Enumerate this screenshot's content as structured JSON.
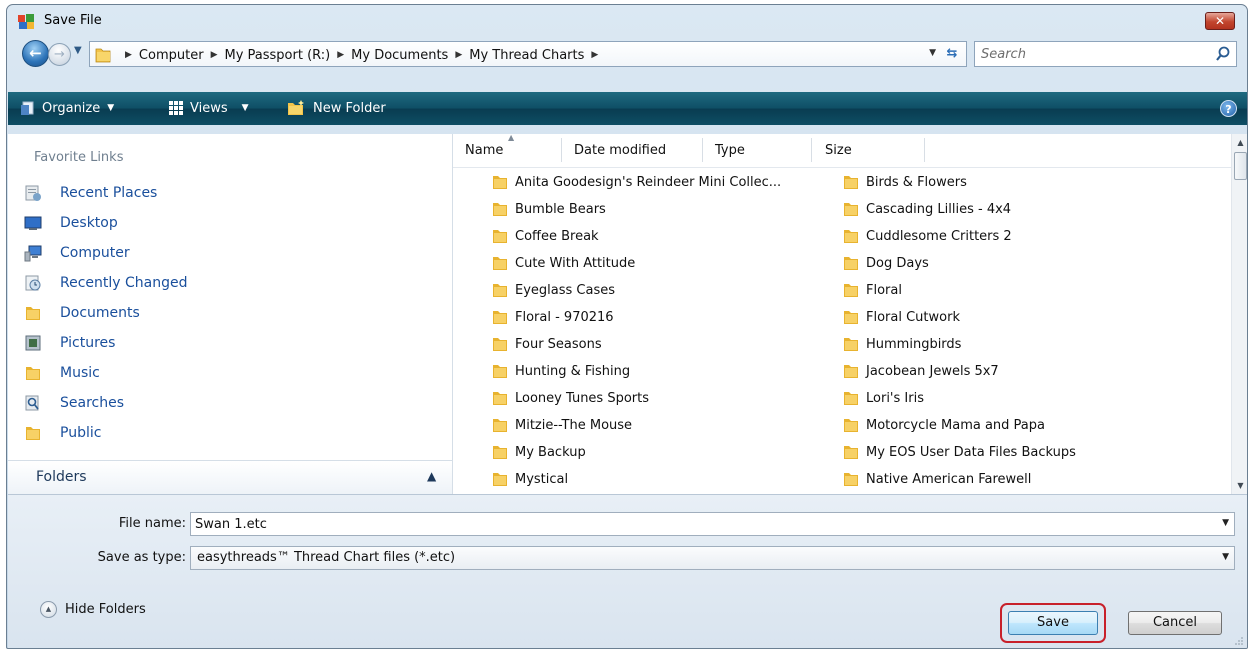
{
  "window": {
    "title": "Save File",
    "close_label": "✕"
  },
  "nav": {
    "breadcrumbs": [
      "Computer",
      "My Passport (R:)",
      "My Documents",
      "My Thread Charts"
    ],
    "search_placeholder": "Search"
  },
  "toolbar": {
    "organize": "Organize",
    "views": "Views",
    "new_folder": "New Folder",
    "help": "?"
  },
  "favorites": {
    "header": "Favorite Links",
    "items": [
      {
        "label": "Recent Places",
        "icon": "recent-places-icon"
      },
      {
        "label": "Desktop",
        "icon": "desktop-icon"
      },
      {
        "label": "Computer",
        "icon": "computer-icon"
      },
      {
        "label": "Recently Changed",
        "icon": "recently-changed-icon"
      },
      {
        "label": "Documents",
        "icon": "documents-folder-icon"
      },
      {
        "label": "Pictures",
        "icon": "pictures-icon"
      },
      {
        "label": "Music",
        "icon": "music-folder-icon"
      },
      {
        "label": "Searches",
        "icon": "searches-icon"
      },
      {
        "label": "Public",
        "icon": "public-folder-icon"
      }
    ],
    "folders_label": "Folders"
  },
  "columns": [
    "Name",
    "Date modified",
    "Type",
    "Size"
  ],
  "files": {
    "col1": [
      "Anita Goodesign's Reindeer Mini Collec...",
      "Bumble Bears",
      "Coffee Break",
      "Cute With Attitude",
      "Eyeglass Cases",
      "Floral - 970216",
      "Four Seasons",
      "Hunting & Fishing",
      "Looney Tunes Sports",
      "Mitzie--The Mouse",
      "My Backup",
      "Mystical"
    ],
    "col2": [
      "Birds & Flowers",
      "Cascading Lillies - 4x4",
      "Cuddlesome Critters 2",
      "Dog Days",
      "Floral",
      "Floral Cutwork",
      "Hummingbirds",
      "Jacobean Jewels 5x7",
      "Lori's Iris",
      "Motorcycle Mama and Papa",
      "My EOS User Data Files Backups",
      "Native American Farewell"
    ]
  },
  "form": {
    "file_name_label": "File name:",
    "file_name_value": "Swan 1.etc",
    "save_type_label": "Save as type:",
    "save_type_value": "easythreads™ Thread Chart files (*.etc)"
  },
  "footer": {
    "hide_folders": "Hide Folders",
    "save": "Save",
    "cancel": "Cancel"
  },
  "colors": {
    "toolbar": "#0f4f66",
    "link": "#1a4f9c",
    "highlight": "#c8202a"
  }
}
